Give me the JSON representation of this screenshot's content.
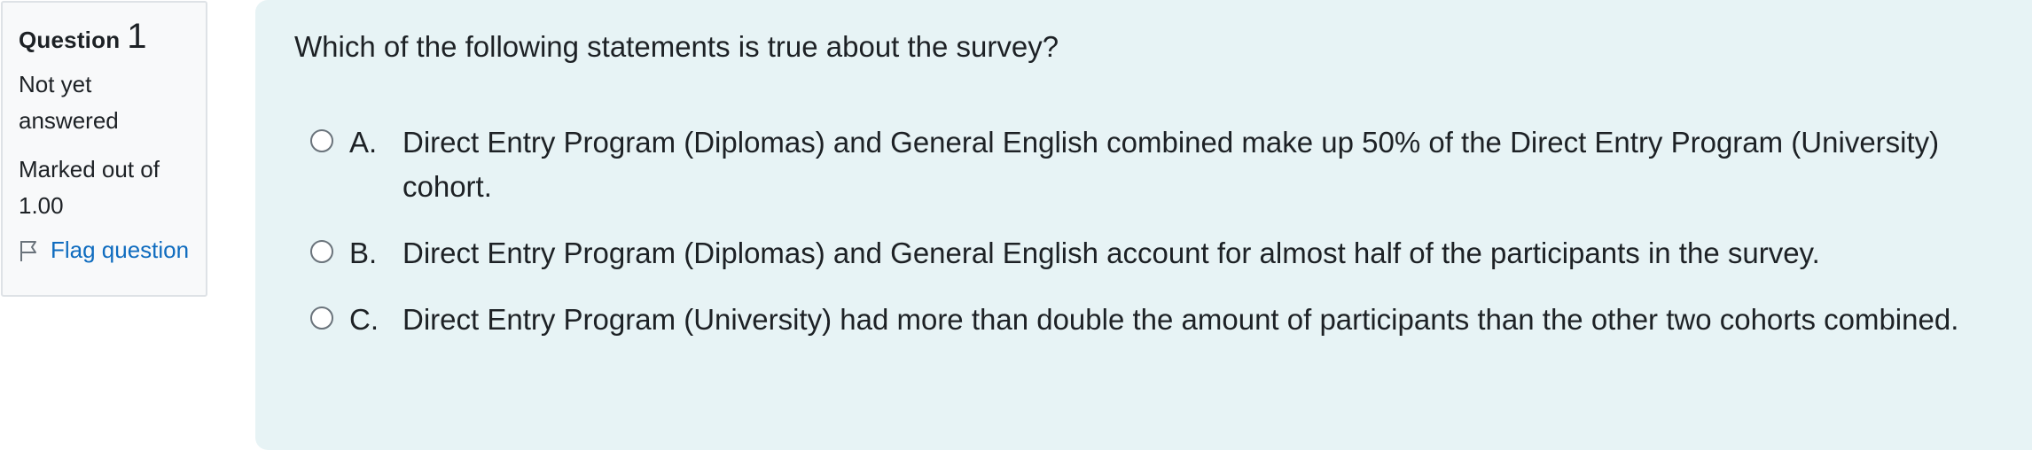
{
  "info": {
    "question_word": "Question",
    "question_number": "1",
    "status": "Not yet answered",
    "marked": "Marked out of 1.00",
    "flag_label": "Flag question"
  },
  "question": {
    "text": "Which of the following statements is true about the survey?",
    "answers": [
      {
        "letter": "A.",
        "text": "Direct Entry Program (Diplomas) and General English combined make up 50% of the Direct Entry Program (University) cohort.",
        "selected": false
      },
      {
        "letter": "B.",
        "text": "Direct Entry Program (Diplomas) and General English account for almost half of the participants in the survey.",
        "selected": false
      },
      {
        "letter": "C.",
        "text": "Direct Entry Program (University) had more than double the amount of participants than the other two cohorts combined.",
        "selected": false
      }
    ]
  }
}
